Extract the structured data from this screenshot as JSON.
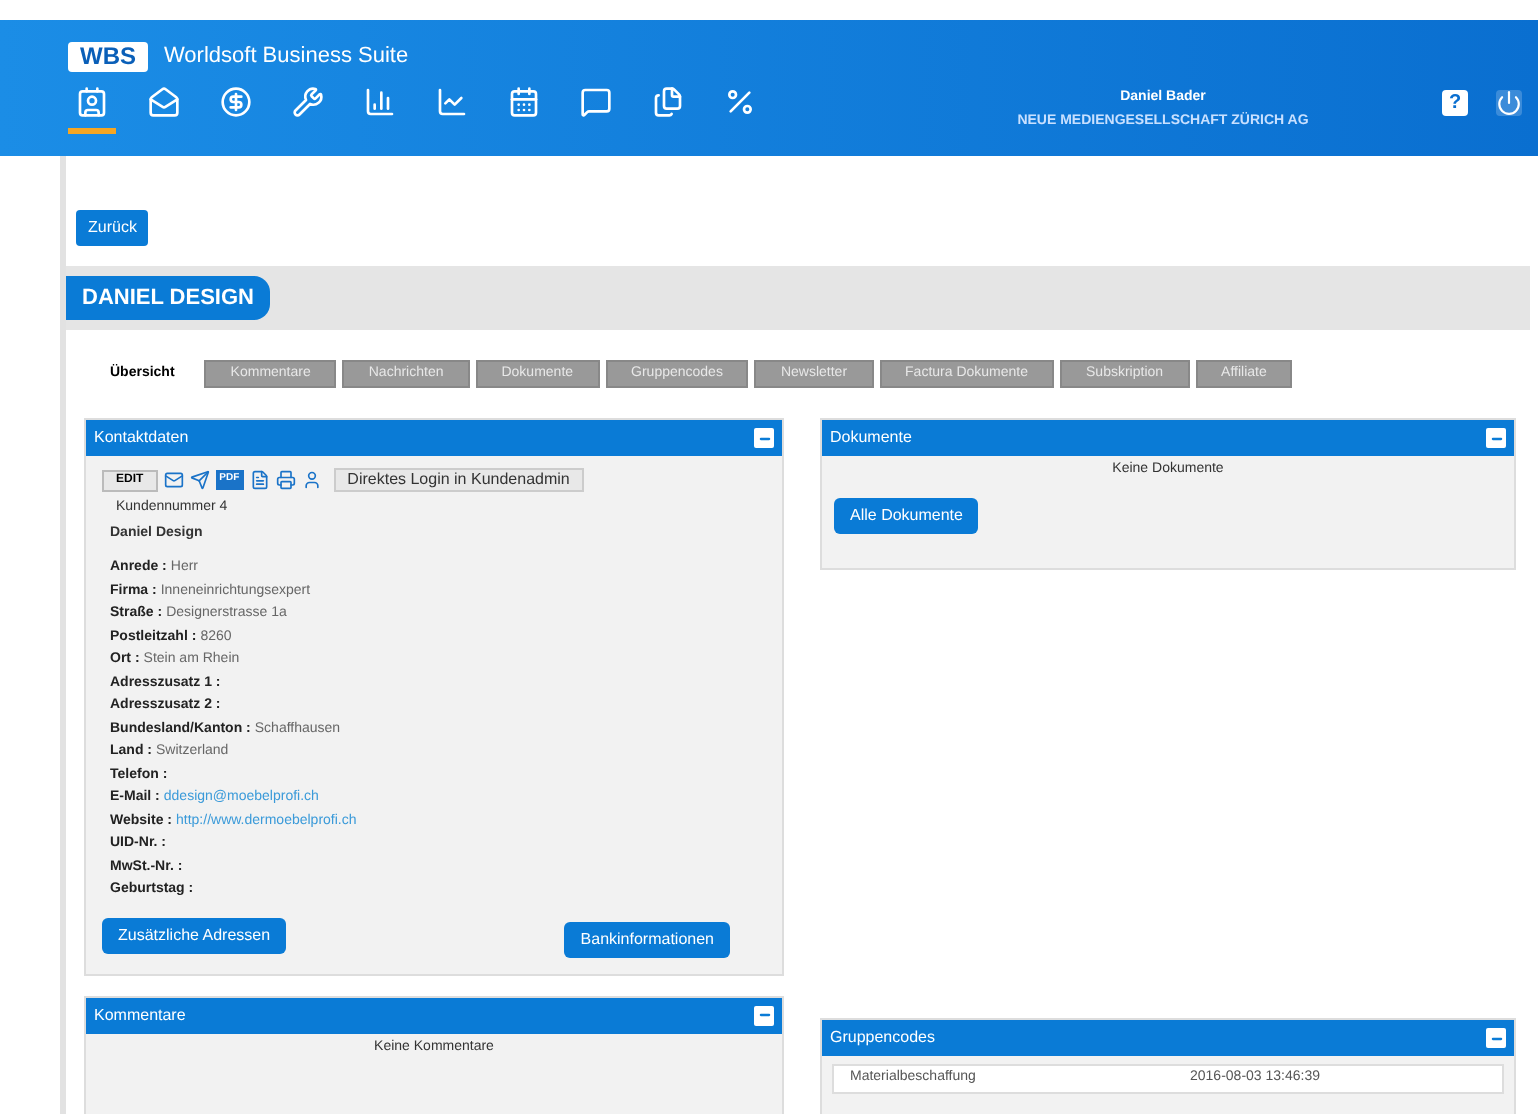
{
  "header": {
    "logo": "WBS",
    "title": "Worldsoft Business Suite",
    "user": "Daniel Bader",
    "company": "NEUE MEDIENGESELLSCHAFT ZÜRICH AG",
    "nav": [
      {
        "kind": "contact",
        "selected": true
      },
      {
        "kind": "mail",
        "selected": false
      },
      {
        "kind": "money",
        "selected": false
      },
      {
        "kind": "tools",
        "selected": false
      },
      {
        "kind": "finance",
        "selected": false
      },
      {
        "kind": "chart",
        "selected": false
      },
      {
        "kind": "calendar",
        "selected": false
      },
      {
        "kind": "message",
        "selected": false
      },
      {
        "kind": "docs",
        "selected": false
      },
      {
        "kind": "percent",
        "selected": false
      }
    ],
    "help": "?"
  },
  "back_button": "Zurück",
  "page_title": "DANIEL DESIGN",
  "tabs": [
    {
      "label": "Übersicht",
      "selected": true
    },
    {
      "label": "Kommentare",
      "selected": false
    },
    {
      "label": "Nachrichten",
      "selected": false
    },
    {
      "label": "Dokumente",
      "selected": false
    },
    {
      "label": "Gruppencodes",
      "selected": false
    },
    {
      "label": "Newsletter",
      "selected": false
    },
    {
      "label": "Factura Dokumente",
      "selected": false
    },
    {
      "label": "Subskription",
      "selected": false
    },
    {
      "label": "Affiliate",
      "selected": false
    }
  ],
  "contact_panel": {
    "title": "Kontaktdaten",
    "toolbar": [
      {
        "kind": "text",
        "label": "EDIT"
      },
      {
        "kind": "mail"
      },
      {
        "kind": "fax"
      },
      {
        "kind": "badge",
        "label": "PDF"
      },
      {
        "kind": "doc"
      },
      {
        "kind": "print"
      },
      {
        "kind": "person"
      }
    ],
    "login_button": "Direktes Login in Kundenadmin",
    "customer_number": "Kundennummer 4",
    "name": "Daniel Design",
    "fields": [
      {
        "label": "Anrede :",
        "value": "Herr",
        "kind": "text"
      },
      {
        "label": "Firma :",
        "value": "Inneneinrichtungsexpert",
        "kind": "text"
      },
      {
        "label": "Straße :",
        "value": "Designerstrasse 1a",
        "kind": "text"
      },
      {
        "label": "Postleitzahl :",
        "value": "8260",
        "kind": "text"
      },
      {
        "label": "Ort :",
        "value": "Stein am Rhein",
        "kind": "text"
      },
      {
        "label": "Adresszusatz 1 :"
      },
      {
        "label": "Adresszusatz 2 :"
      },
      {
        "label": "Bundesland/Kanton :",
        "value": "Schaffhausen",
        "kind": "text"
      },
      {
        "label": "Land :",
        "value": "Switzerland",
        "kind": "text"
      },
      {
        "label": "Telefon :"
      },
      {
        "label": "E-Mail :",
        "value": "ddesign@moebelprofi.ch",
        "kind": "link"
      },
      {
        "label": "Website :",
        "value": "http://www.dermoebelprofi.ch",
        "kind": "link"
      },
      {
        "label": "UID-Nr. :"
      },
      {
        "label": "MwSt.-Nr. :"
      },
      {
        "label": "Geburtstag :"
      }
    ],
    "buttons": [
      "Zusätzliche Adressen",
      "Bankinformationen"
    ]
  },
  "documents_panel": {
    "title": "Dokumente",
    "empty": "Keine Dokumente",
    "button": "Alle Dokumente"
  },
  "comments_panel": {
    "title": "Kommentare",
    "empty": "Keine Kommentare"
  },
  "groups_panel": {
    "title": "Gruppencodes",
    "rows": [
      {
        "name": "Materialbeschaffung",
        "date": "2016-08-03 13:46:39"
      }
    ]
  }
}
